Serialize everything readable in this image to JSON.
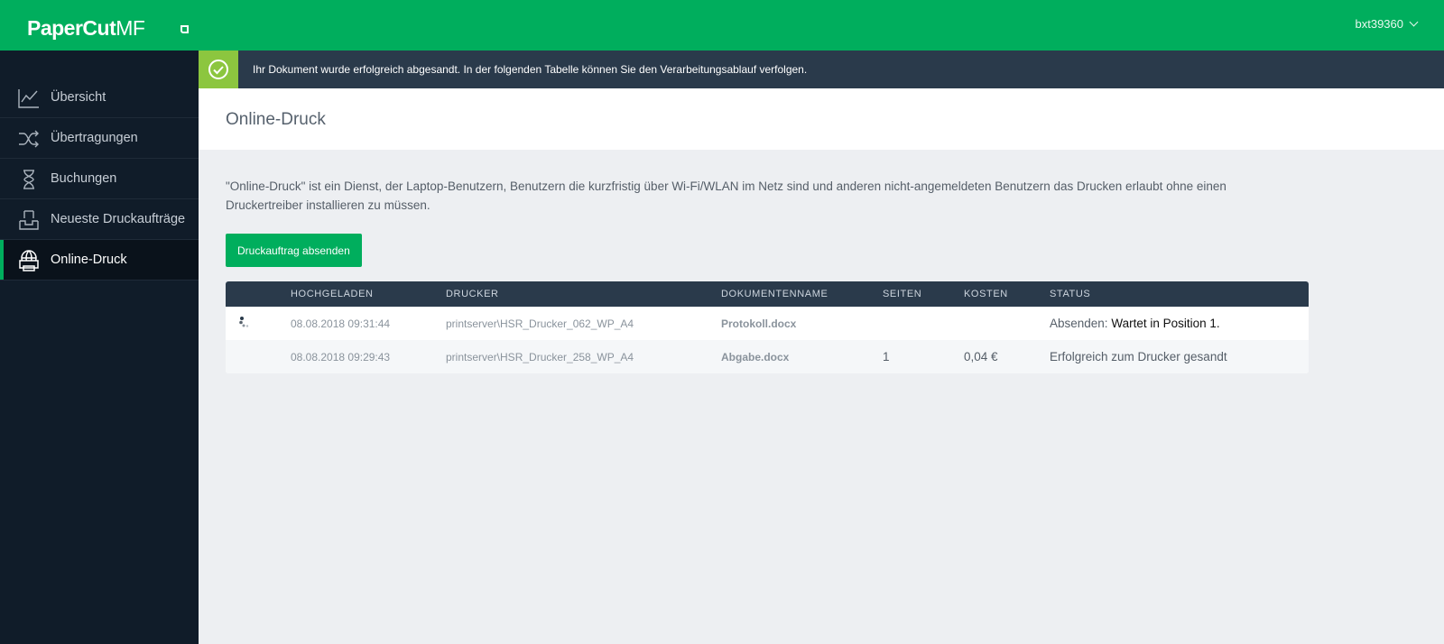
{
  "app": {
    "logo_primary": "PaperCut",
    "logo_secondary": "MF",
    "user": "bxt39360"
  },
  "sidebar": {
    "items": [
      {
        "label": "Übersicht",
        "icon": "line-chart-icon"
      },
      {
        "label": "Übertragungen",
        "icon": "shuffle-icon"
      },
      {
        "label": "Buchungen",
        "icon": "hourglass-icon"
      },
      {
        "label": "Neueste Druckaufträge",
        "icon": "tray-icon"
      },
      {
        "label": "Online-Druck",
        "icon": "web-print-icon",
        "active": true
      }
    ]
  },
  "banner": {
    "icon": "check-circle-icon",
    "message": "Ihr Dokument wurde erfolgreich abgesandt. In der folgenden Tabelle können Sie den Verarbeitungsablauf verfolgen."
  },
  "page": {
    "title": "Online-Druck",
    "intro": "\"Online-Druck\" ist ein Dienst, der Laptop-Benutzern, Benutzern die kurzfristig über Wi-Fi/WLAN im Netz sind und anderen nicht-angemeldeten Benutzern das Drucken erlaubt ohne einen Druckertreiber installieren zu müssen.",
    "submit_button": "Druckauftrag absenden"
  },
  "table": {
    "headers": [
      "",
      "HOCHGELADEN",
      "DRUCKER",
      "DOKUMENTENNAME",
      "SEITEN",
      "KOSTEN",
      "STATUS"
    ],
    "rows": [
      {
        "icon": "spinner-icon",
        "uploaded": "08.08.2018 09:31:44",
        "printer": "printserver\\HSR_Drucker_062_WP_A4",
        "document": "Protokoll.docx",
        "pages": "",
        "cost": "",
        "status_label": "Absenden:",
        "status_value": "Wartet in Position 1."
      },
      {
        "icon": "",
        "uploaded": "08.08.2018 09:29:43",
        "printer": "printserver\\HSR_Drucker_258_WP_A4",
        "document": "Abgabe.docx",
        "pages": "1",
        "cost": "0,04 €",
        "status_label": "Erfolgreich zum Drucker gesandt",
        "status_value": ""
      }
    ]
  },
  "colors": {
    "brand_green": "#00ae5d",
    "sidebar_bg": "#101c29",
    "banner_bg": "#2a3a4b",
    "success_accent": "#8cc63f"
  }
}
